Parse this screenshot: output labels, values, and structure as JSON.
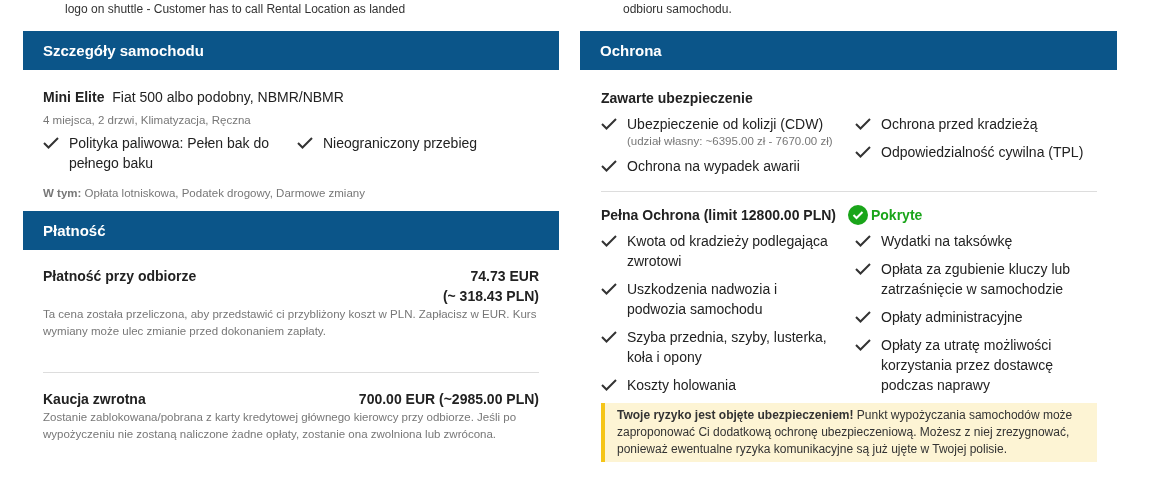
{
  "top_notes": [
    "logo on shuttle - Customer has to call Rental Location as landed",
    "odbioru samochodu."
  ],
  "car_details": {
    "title": "Szczegóły samochodu",
    "model_class": "Mini Elite",
    "model": "Fiat 500 albo podobny, NBMR/NBMR",
    "specs": "4 miejsca, 2 drzwi, Klimatyzacja, Ręczna",
    "features": [
      "Polityka paliwowa: Pełen bak do pełnego baku",
      "Nieograniczony przebieg"
    ],
    "included": "**W tym:** Opłata lotniskowa, Podatek drogowy, Darmowe zmiany"
  },
  "payment": {
    "title": "Płatność",
    "rows": [
      {
        "label": "Płatność przy odbiorze",
        "amount_lines": [
          "74.73 EUR",
          "(~ 318.43 PLN)"
        ],
        "note": "Ta cena została przeliczona, aby przedstawić ci przybliżony koszt w PLN. Zapłacisz w EUR. Kurs wymiany może ulec zmianie przed dokonaniem zapłaty."
      },
      {
        "label": "Kaucja zwrotna",
        "amount_lines": [
          "700.00 EUR (~2985.00 PLN)"
        ],
        "note": "Zostanie zablokowana/pobrana z karty kredytowej głównego kierowcy przy odbiorze. Jeśli po wypożyczeniu nie zostaną naliczone żadne opłaty, zostanie ona zwolniona lub zwrócona."
      }
    ]
  },
  "protection": {
    "title": "Ochrona",
    "included": {
      "title": "Zawarte ubezpieczenie",
      "columns": [
        [
          {
            "text": "Ubezpieczenie od kolizji (CDW)",
            "note": "(udział własny: ~6395.00 zł - 7670.00 zł)"
          },
          {
            "text": "Ochrona na wypadek awarii"
          }
        ],
        [
          {
            "text": "Ochrona przed kradzieżą"
          },
          {
            "text": "Odpowiedzialność cywilna (TPL)"
          }
        ]
      ]
    },
    "full": {
      "title": "Pełna Ochrona (limit 12800.00 PLN)",
      "status": {
        "label": "Pokryte",
        "covered": true
      },
      "columns": [
        [
          {
            "text": "Kwota od kradzieży podlegająca zwrotowi"
          },
          {
            "text": "Uszkodzenia nadwozia i podwozia samochodu"
          },
          {
            "text": "Szyba przednia, szyby, lusterka, koła i opony"
          },
          {
            "text": "Koszty holowania"
          }
        ],
        [
          {
            "text": "Wydatki na taksówkę"
          },
          {
            "text": "Opłata za zgubienie kluczy lub zatrzaśnięcie w samochodzie"
          },
          {
            "text": "Opłaty administracyjne"
          },
          {
            "text": "Opłaty za utratę możliwości korzystania przez dostawcę podczas naprawy"
          }
        ]
      ]
    },
    "note": "**Twoje ryzyko jest objęte ubezpieczeniem!** Punkt wypożyczania samochodów może zaproponować Ci dodatkową ochronę ubezpieczeniową. Możesz z niej zrezygnować, ponieważ ewentualne ryzyka komunikacyjne są już ujęte w Twojej polisie."
  }
}
